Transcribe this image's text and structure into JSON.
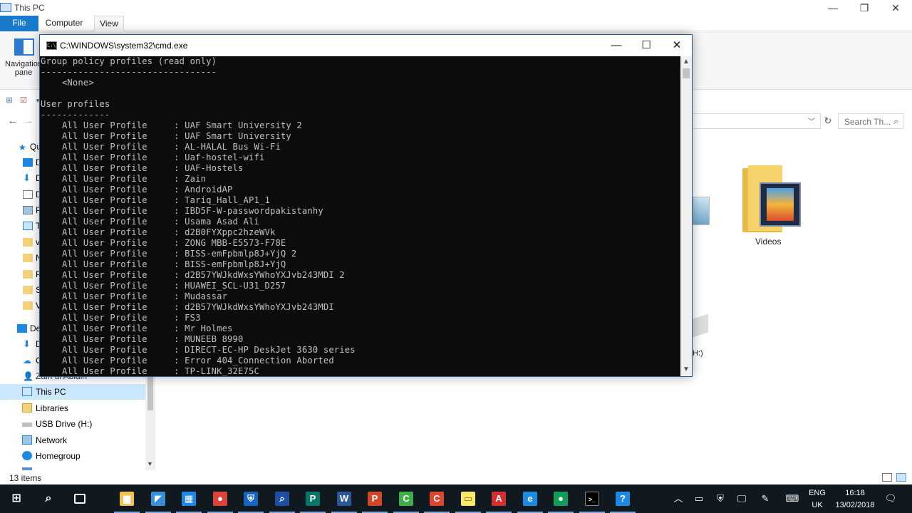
{
  "explorer": {
    "title": "This PC",
    "ribbon_tabs": {
      "file": "File",
      "computer": "Computer",
      "view": "View"
    },
    "ribbon": {
      "navigation_pane_label": "Navigation pane"
    },
    "search_placeholder": "Search Th...",
    "sidebar": {
      "partial_rows": [
        "Qu",
        "D",
        "D",
        "D",
        "Pi",
        "T",
        "v",
        "N",
        "P",
        "S",
        "V",
        "De",
        "D",
        "C",
        "Zain ul Abidin"
      ],
      "items": [
        {
          "label": "This PC",
          "icon": "computer-icon",
          "selected": true
        },
        {
          "label": "Libraries",
          "icon": "libraries-icon",
          "selected": false
        },
        {
          "label": "USB Drive (H:)",
          "icon": "usb-drive-icon",
          "selected": false
        },
        {
          "label": "Network",
          "icon": "network-icon",
          "selected": false
        },
        {
          "label": "Homegroup",
          "icon": "homegroup-icon",
          "selected": false
        }
      ]
    },
    "content": {
      "videos_label": "Videos",
      "drive_fragment": "H:)"
    },
    "status_text": "13 items"
  },
  "cmd": {
    "title": "C:\\WINDOWS\\system32\\cmd.exe",
    "lines": [
      "Group policy profiles (read only)",
      "---------------------------------",
      "    <None>",
      "",
      "User profiles",
      "-------------",
      "    All User Profile     : UAF Smart University 2",
      "    All User Profile     : UAF Smart University",
      "    All User Profile     : AL-HALAL Bus Wi-Fi",
      "    All User Profile     : Uaf-hostel-wifi",
      "    All User Profile     : UAF-Hostels",
      "    All User Profile     : Zain",
      "    All User Profile     : AndroidAP",
      "    All User Profile     : Tariq_Hall_AP1_1",
      "    All User Profile     : IBD5F-W-passwordpakistanhy",
      "    All User Profile     : Usama Asad Ali",
      "    All User Profile     : d2B0FYXppc2hzeWVk",
      "    All User Profile     : ZONG MBB-E5573-F78E",
      "    All User Profile     : BISS-emFpbmlp8J+YjQ 2",
      "    All User Profile     : BISS-emFpbmlp8J+YjQ",
      "    All User Profile     : d2B57YWJkdWxsYWhoYXJvb243MDI 2",
      "    All User Profile     : HUAWEI_SCL-U31_D257",
      "    All User Profile     : Mudassar",
      "    All User Profile     : d2B57YWJkdWxsYWhoYXJvb243MDI",
      "    All User Profile     : FS3",
      "    All User Profile     : Mr Holmes",
      "    All User Profile     : MUNEEB 8990",
      "    All User Profile     : DIRECT-EC-HP DeskJet 3630 series",
      "    All User Profile     : Error 404_Connection Aborted",
      "    All User Profile     : TP-LINK_32E75C"
    ]
  },
  "taskbar": {
    "apps": [
      {
        "name": "file-explorer",
        "icon": "folder-icon",
        "color": "#f2c14e",
        "glyph": "▆"
      },
      {
        "name": "store-like",
        "icon": "app-icon",
        "color": "#3b8fd8",
        "glyph": "◤"
      },
      {
        "name": "store",
        "icon": "store-icon",
        "color": "#1e88e5",
        "glyph": "▦"
      },
      {
        "name": "chrome-1",
        "icon": "chrome-icon",
        "color": "#db4437",
        "glyph": "●"
      },
      {
        "name": "defender",
        "icon": "shield-icon",
        "color": "#1565c0",
        "glyph": "⛨"
      },
      {
        "name": "search-app",
        "icon": "magnifier-app-icon",
        "color": "#1e4fa3",
        "glyph": "⌕"
      },
      {
        "name": "publisher",
        "icon": "publisher-icon",
        "color": "#077568",
        "glyph": "P"
      },
      {
        "name": "word",
        "icon": "word-icon",
        "color": "#2b579a",
        "glyph": "W"
      },
      {
        "name": "powerpoint",
        "icon": "powerpoint-icon",
        "color": "#d24726",
        "glyph": "P"
      },
      {
        "name": "camtasia-green",
        "icon": "camtasia-icon",
        "color": "#3fae49",
        "glyph": "C"
      },
      {
        "name": "camtasia-red",
        "icon": "camtasia-recorder-icon",
        "color": "#e0452f",
        "glyph": "C"
      },
      {
        "name": "sticky-notes",
        "icon": "sticky-notes-icon",
        "color": "#f6e96b",
        "glyph": "▭"
      },
      {
        "name": "acrobat",
        "icon": "acrobat-icon",
        "color": "#d32f2f",
        "glyph": "A"
      },
      {
        "name": "edge",
        "icon": "edge-icon",
        "color": "#1d8ce0",
        "glyph": "e"
      },
      {
        "name": "chrome-2",
        "icon": "chrome-icon",
        "color": "#0f9d58",
        "glyph": "●"
      },
      {
        "name": "cmd",
        "icon": "command-prompt-icon",
        "color": "#000000",
        "glyph": ">_"
      },
      {
        "name": "help",
        "icon": "help-icon",
        "color": "#1e88e5",
        "glyph": "?"
      }
    ],
    "tray": {
      "language": "ENG",
      "region": "UK",
      "time": "16:18",
      "date": "13/02/2018"
    }
  },
  "colors": {
    "accent": "#1979ca",
    "console_bg": "#0c0c0c",
    "console_text": "#c0c0c0",
    "taskbar": "#101820",
    "selection": "#cce8ff"
  }
}
